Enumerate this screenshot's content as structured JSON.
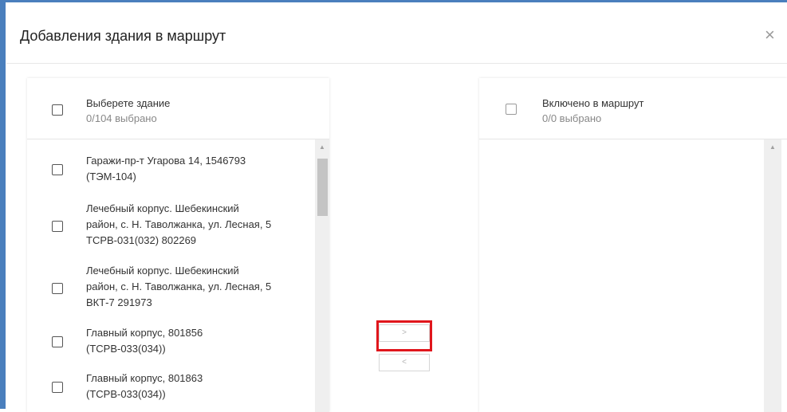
{
  "dialog": {
    "title": "Добавления здания в маршрут",
    "close_glyph": "×"
  },
  "left_panel": {
    "title": "Выберете здание",
    "count": "0/104 выбрано",
    "items": [
      {
        "line1": "Гаражи-пр-т Угарова 14, 1546793",
        "line2": "(ТЭМ-104)",
        "line3": ""
      },
      {
        "line1": "Лечебный корпус. Шебекинский",
        "line2": "район, с. Н. Таволжанка, ул. Лесная, 5",
        "line3": "ТСРВ-031(032) 802269"
      },
      {
        "line1": "Лечебный корпус. Шебекинский",
        "line2": "район, с. Н. Таволжанка, ул. Лесная, 5",
        "line3": "ВКТ-7 291973"
      },
      {
        "line1": "Главный корпус, 801856",
        "line2": "(ТСРВ-033(034))",
        "line3": ""
      },
      {
        "line1": "Главный корпус, 801863",
        "line2": "(ТСРВ-033(034))",
        "line3": ""
      }
    ]
  },
  "right_panel": {
    "title": "Включено в маршрут",
    "count": "0/0 выбрано"
  },
  "transfer": {
    "move_right_label": ">",
    "move_left_label": "<"
  },
  "scroll_arrow_up": "▲",
  "colors": {
    "frame": "#4a7fbd",
    "highlight": "#e0161c"
  }
}
